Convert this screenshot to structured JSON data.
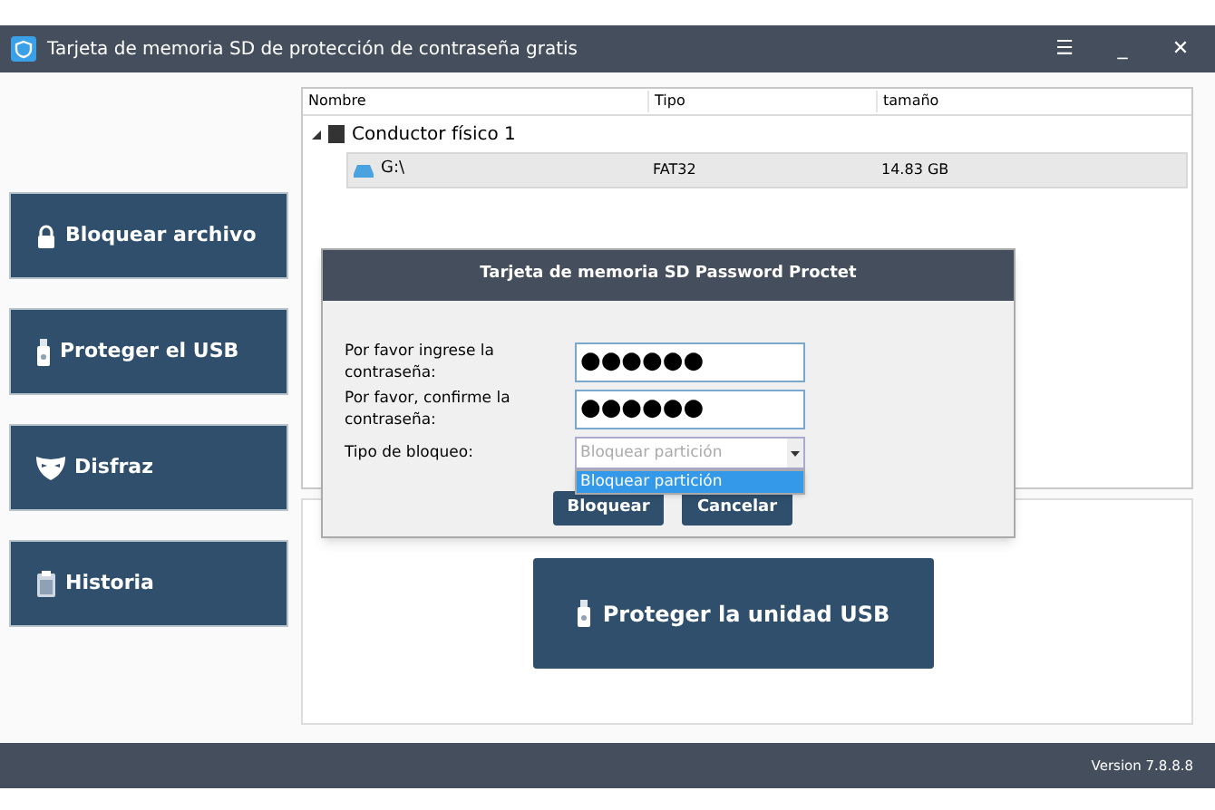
{
  "window": {
    "title": "Tarjeta de memoria SD de protección de contraseña gratis",
    "controls": [
      "☰",
      "_",
      "✕"
    ]
  },
  "sidebar": {
    "items": [
      {
        "label": "Bloquear archivo",
        "kind": "lock"
      },
      {
        "label": "Proteger el USB",
        "kind": "usb"
      },
      {
        "label": "Disfraz",
        "kind": "mask"
      },
      {
        "label": "Historia",
        "kind": "clipboard"
      }
    ]
  },
  "table": {
    "columns": [
      "Nombre",
      "Tipo",
      "tamaño"
    ],
    "rows": [
      {
        "name": "Conductor físico 1",
        "kind": "disk",
        "expanded": true,
        "selected": false,
        "children": [
          {
            "name": "G:\\",
            "kind": "drive",
            "type": "FAT32",
            "size": "14.83 GB",
            "selected": true
          }
        ]
      }
    ]
  },
  "main_button": {
    "label": "Proteger la unidad USB"
  },
  "dialog": {
    "title": "Tarjeta de memoria SD Password Proctet",
    "fields": [
      {
        "label": "Por favor ingrese la contraseña:",
        "value": "●●●●●●"
      },
      {
        "label": "Por favor, confirme la contraseña:",
        "value": "●●●●●●"
      }
    ],
    "lock_type": {
      "label": "Tipo de bloqueo:",
      "placeholder": "Bloquear partición",
      "open": true,
      "options": [
        {
          "label": "Bloquear partición",
          "selected": true
        }
      ]
    },
    "buttons": [
      "Bloquear",
      "Cancelar"
    ]
  },
  "status_bar": {
    "version": "Version 7.8.8.8"
  }
}
